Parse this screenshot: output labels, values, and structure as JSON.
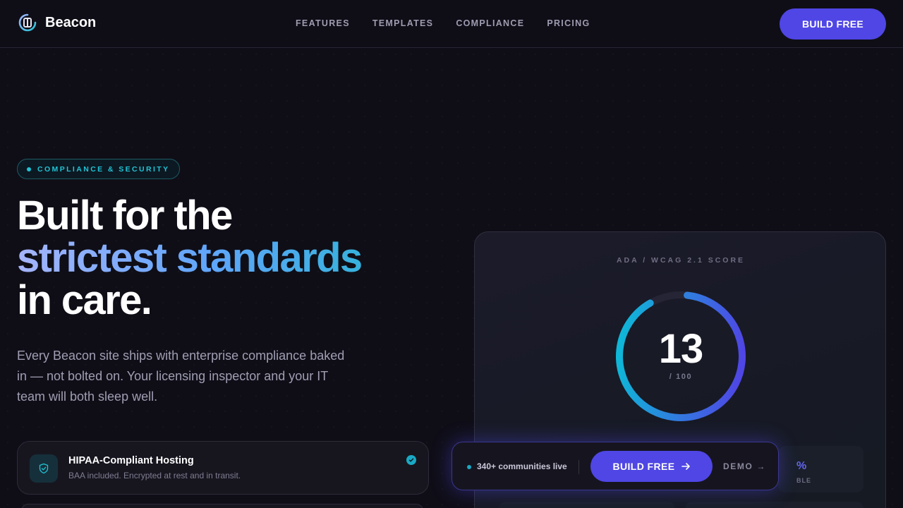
{
  "nav": {
    "brand": "Beacon",
    "links": [
      "FEATURES",
      "TEMPLATES",
      "COMPLIANCE",
      "PRICING"
    ],
    "cta_label": "BUILD FREE"
  },
  "hero": {
    "eyebrow": "COMPLIANCE & SECURITY",
    "headline_line1": "Built for the",
    "headline_line2": "strictest standards",
    "headline_line3": "in care.",
    "lede": "Every Beacon site ships with enterprise compliance baked in — not bolted on. Your licensing inspector and your IT team will both sleep well."
  },
  "features": [
    {
      "title": "HIPAA-Compliant Hosting",
      "description": "BAA included. Encrypted at rest and in transit.",
      "icon": "shield-check-icon",
      "checked": true
    }
  ],
  "score_panel": {
    "label": "ADA / WCAG 2.1 SCORE",
    "score": "13",
    "max": "/ 100",
    "score_fraction": 0.9,
    "stat_value_partial": "%",
    "stat_label_partial": "BLE"
  },
  "cta_bar": {
    "live_text": "340+ communities live",
    "primary_label": "BUILD FREE",
    "secondary_label": "DEMO →"
  },
  "colors": {
    "accent": "#4f46e5",
    "teal": "#22c3d6",
    "background": "#0f0e17"
  }
}
